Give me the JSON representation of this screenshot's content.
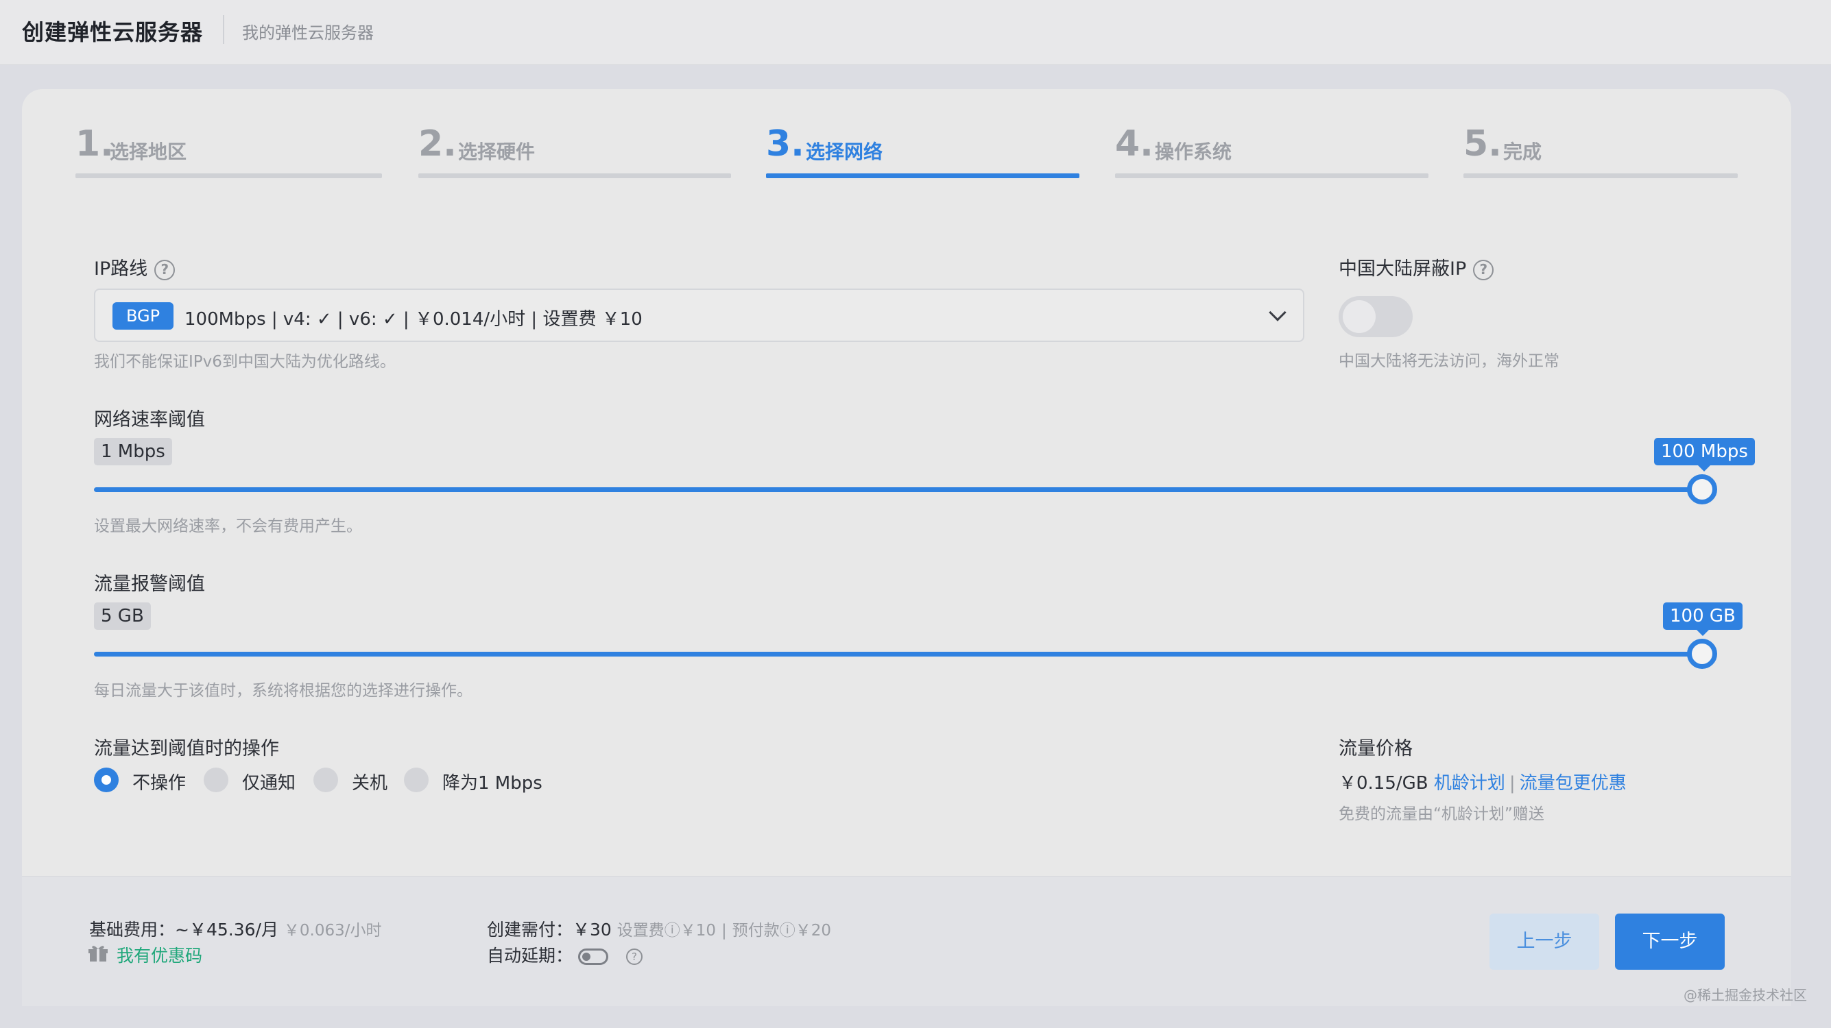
{
  "header": {
    "title": "创建弹性云服务器",
    "breadcrumb": "我的弹性云服务器"
  },
  "steps": [
    {
      "num": "1.",
      "label": "选择地区",
      "active": false
    },
    {
      "num": "2.",
      "label": "选择硬件",
      "active": false
    },
    {
      "num": "3.",
      "label": "选择网络",
      "active": true
    },
    {
      "num": "4.",
      "label": "操作系统",
      "active": false
    },
    {
      "num": "5.",
      "label": "完成",
      "active": false
    }
  ],
  "ip_route": {
    "label": "IP路线",
    "badge": "BGP",
    "selected_text": "100Mbps | v4: ✓ | v6: ✓ | ￥0.014/小时 | 设置费 ￥10",
    "hint": "我们不能保证IPv6到中国大陆为优化路线。"
  },
  "mainland_block": {
    "label": "中国大陆屏蔽IP",
    "enabled": false,
    "hint": "中国大陆将无法访问，海外正常"
  },
  "rate_limit": {
    "label": "网络速率阈值",
    "min_label": "1 Mbps",
    "value_label": "100 Mbps",
    "value_fraction": 1.0,
    "hint": "设置最大网络速率，不会有费用产生。"
  },
  "traffic_alert": {
    "label": "流量报警阈值",
    "min_label": "5 GB",
    "value_label": "100 GB",
    "value_fraction": 1.0,
    "hint": "每日流量大于该值时，系统将根据您的选择进行操作。"
  },
  "threshold_action": {
    "label": "流量达到阈值时的操作",
    "options": [
      "不操作",
      "仅通知",
      "关机",
      "降为1 Mbps"
    ],
    "selected_index": 0
  },
  "traffic_price": {
    "label": "流量价格",
    "price": "￥0.15/GB",
    "link_1": "机龄计划",
    "separator": "|",
    "link_2": "流量包更优惠",
    "hint": "免费的流量由“机龄计划”赠送"
  },
  "footer": {
    "base_fee_label": "基础费用：~￥45.36/月",
    "base_fee_hourly": "￥0.063/小时",
    "coupon_link": "我有优惠码",
    "create_pay_label": "创建需付：",
    "create_pay_value": "￥30",
    "create_pay_detail_1": "设置费",
    "create_pay_detail_1_value": "￥10",
    "create_pay_sep": "|",
    "create_pay_detail_2": "预付款",
    "create_pay_detail_2_value": "￥20",
    "auto_renew_label": "自动延期：",
    "prev_button": "上一步",
    "next_button": "下一步"
  },
  "watermark": "@稀土掘金技术社区",
  "colors": {
    "accent": "#2f81e0",
    "coupon": "#1fa77a",
    "muted": "#9a9da3"
  }
}
